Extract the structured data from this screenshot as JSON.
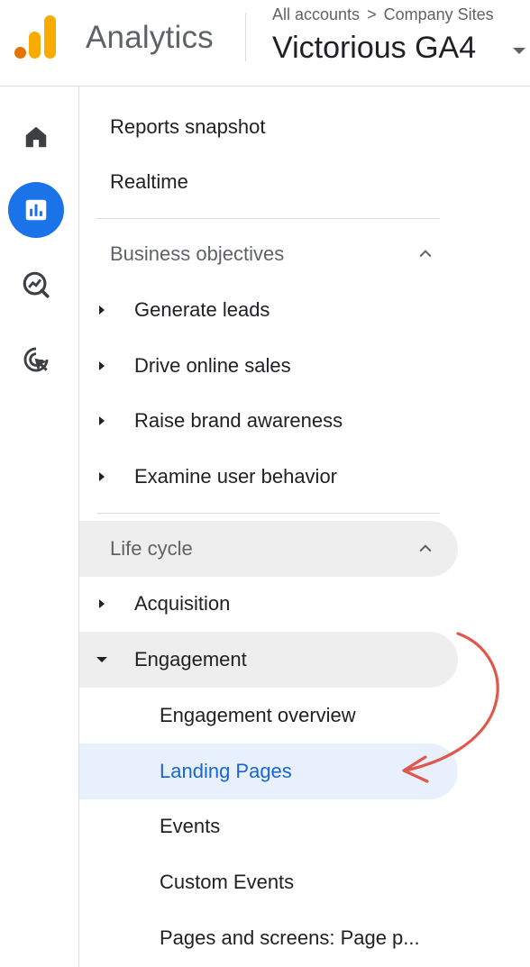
{
  "header": {
    "app_name": "Analytics",
    "breadcrumb_accounts": "All accounts",
    "breadcrumb_sep": ">",
    "breadcrumb_site": "Company Sites",
    "property_name": "Victorious GA4"
  },
  "rail": {
    "items": [
      {
        "icon": "home-icon",
        "active": false
      },
      {
        "icon": "reports-icon",
        "active": true
      },
      {
        "icon": "explore-icon",
        "active": false
      },
      {
        "icon": "advertising-icon",
        "active": false
      }
    ]
  },
  "nav": {
    "reports_snapshot": "Reports snapshot",
    "realtime": "Realtime",
    "business_objectives": {
      "title": "Business objectives",
      "items": [
        "Generate leads",
        "Drive online sales",
        "Raise brand awareness",
        "Examine user behavior"
      ]
    },
    "life_cycle": {
      "title": "Life cycle",
      "acquisition": "Acquisition",
      "engagement": {
        "label": "Engagement",
        "items": [
          "Engagement overview",
          "Landing Pages",
          "Events",
          "Custom Events",
          "Pages and screens: Page p..."
        ]
      }
    }
  },
  "annotation": {
    "arrow_color": "#e0574b",
    "points_to": "Landing Pages"
  },
  "colors": {
    "accent": "#1a73e8",
    "selected_text": "#1967d2",
    "selected_bg": "#e8f0fe",
    "expanded_bg": "#eeeeee"
  }
}
